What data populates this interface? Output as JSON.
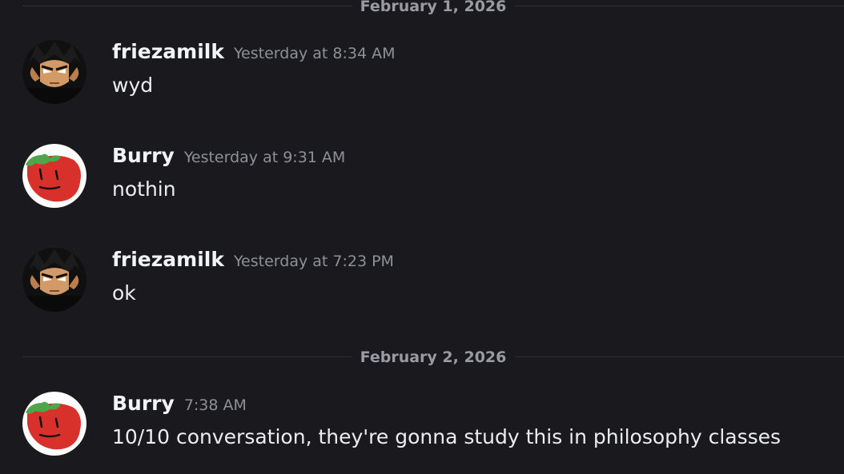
{
  "dividers": [
    {
      "label": "February 1, 2026"
    },
    {
      "label": "February 2, 2026"
    }
  ],
  "messages": [
    {
      "author": "friezamilk",
      "timestamp": "Yesterday at 8:34 AM",
      "text": "wyd",
      "avatar": "anime-character-avatar"
    },
    {
      "author": "Burry",
      "timestamp": "Yesterday at 9:31 AM",
      "text": "nothin",
      "avatar": "strawberry-face-avatar"
    },
    {
      "author": "friezamilk",
      "timestamp": "Yesterday at 7:23 PM",
      "text": "ok",
      "avatar": "anime-character-avatar"
    },
    {
      "author": "Burry",
      "timestamp": "7:38 AM",
      "text": "10/10 conversation, they're gonna study this in philosophy classes",
      "avatar": "strawberry-face-avatar"
    }
  ],
  "colors": {
    "background": "#1a1a1e",
    "username": "#f2f3f5",
    "timestamp": "#8e9098",
    "divider_line": "#2f3036",
    "strawberry_red": "#d8302a",
    "strawberry_leaf": "#4fa64a"
  }
}
